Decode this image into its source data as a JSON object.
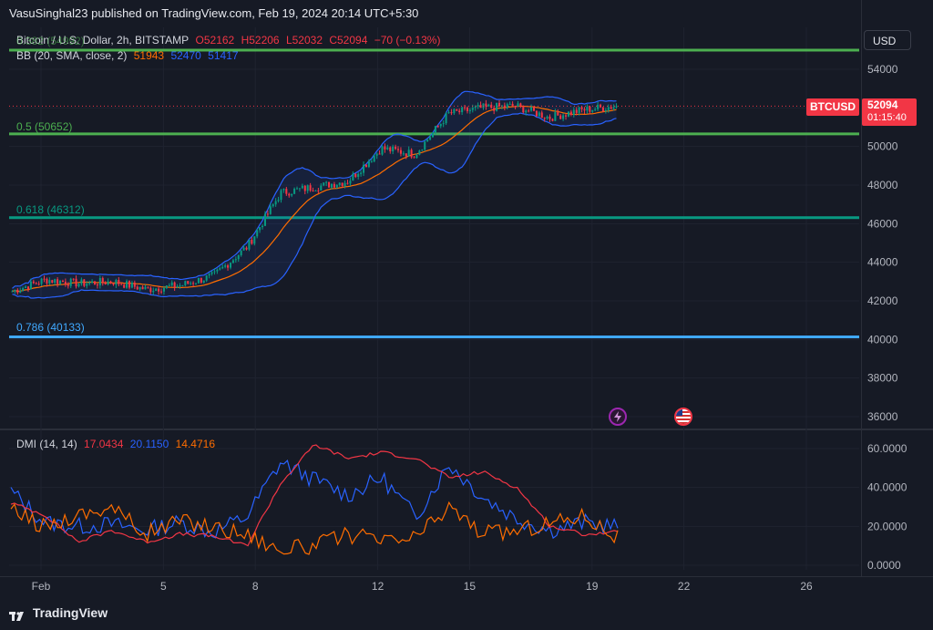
{
  "header": {
    "published": "VasuSinghal23 published on TradingView.com, Feb 19, 2024 20:14 UTC+5:30"
  },
  "currency_button": "USD",
  "symbol_tag": "BTCUSD",
  "last_price": "52094",
  "countdown": "01:15:40",
  "footer_brand": "TradingView",
  "main_legend": {
    "symbol": "Bitcoin / U.S. Dollar, 2h, BITSTAMP",
    "o": "O52162",
    "h": "H52206",
    "l": "L52032",
    "c": "C52094",
    "change": "−70 (−0.13%)",
    "bb_label": "BB (20, SMA, close, 2)",
    "bb_basis": "51943",
    "bb_upper": "52470",
    "bb_lower": "51417"
  },
  "dmi_legend": {
    "label": "DMI (14, 14)",
    "v1": "17.0434",
    "v2": "20.1150",
    "v3": "14.4716"
  },
  "colors": {
    "up": "#089981",
    "down": "#f23645",
    "bb_band": "#2962ff",
    "bb_basis": "#ff6d00",
    "dmi_plus": "#2962ff",
    "dmi_minus": "#f23645",
    "adx": "#ff6d00"
  },
  "fib_levels": [
    {
      "label": "0.382 (54992)",
      "value": 54992,
      "color": "#4caf50"
    },
    {
      "label": "0.5 (50652)",
      "value": 50652,
      "color": "#4caf50"
    },
    {
      "label": "0.618 (46312)",
      "value": 46312,
      "color": "#089981"
    },
    {
      "label": "0.786 (40133)",
      "value": 40133,
      "color": "#40a9ff"
    }
  ],
  "chart_data": [
    {
      "type": "candlestick",
      "title": "Bitcoin / U.S. Dollar, 2h, BITSTAMP",
      "ylim": [
        35000,
        55500
      ],
      "y_ticks": [
        "54000",
        "52000",
        "50000",
        "48000",
        "46000",
        "44000",
        "42000",
        "40000",
        "38000",
        "36000"
      ],
      "x_ticks": [
        "Feb",
        "5",
        "8",
        "12",
        "15",
        "19",
        "22",
        "26"
      ],
      "series": [
        {
          "name": "Price (approx. close)",
          "x": [
            "Feb 1",
            "Feb 2",
            "Feb 3",
            "Feb 4",
            "Feb 5",
            "Feb 6",
            "Feb 7",
            "Feb 8",
            "Feb 9",
            "Feb 10",
            "Feb 11",
            "Feb 12",
            "Feb 13",
            "Feb 14",
            "Feb 15",
            "Feb 16",
            "Feb 17",
            "Feb 18",
            "Feb 19"
          ],
          "values": [
            42500,
            43100,
            42900,
            43000,
            42600,
            42800,
            43300,
            44800,
            47600,
            47900,
            48200,
            49900,
            49600,
            51700,
            52000,
            52100,
            51500,
            51900,
            52094
          ]
        }
      ]
    },
    {
      "type": "line",
      "title": "DMI (14, 14)",
      "ylim": [
        0,
        65
      ],
      "y_ticks": [
        "60.0000",
        "40.0000",
        "20.0000",
        "0.0000"
      ],
      "x": [
        "Feb 1",
        "Feb 2",
        "Feb 3",
        "Feb 4",
        "Feb 5",
        "Feb 6",
        "Feb 7",
        "Feb 8",
        "Feb 9",
        "Feb 10",
        "Feb 11",
        "Feb 12",
        "Feb 13",
        "Feb 14",
        "Feb 15",
        "Feb 16",
        "Feb 17",
        "Feb 18",
        "Feb 19"
      ],
      "series": [
        {
          "values": [
            38,
            22,
            20,
            21,
            18,
            22,
            17,
            25,
            53,
            44,
            36,
            45,
            25,
            52,
            35,
            24,
            18,
            22,
            20
          ]
        },
        {
          "values": [
            32,
            26,
            12,
            18,
            12,
            16,
            15,
            10,
            42,
            62,
            55,
            58,
            55,
            45,
            48,
            40,
            20,
            16,
            17
          ]
        },
        {
          "values": [
            28,
            20,
            26,
            30,
            16,
            23,
            20,
            16,
            8,
            10,
            16,
            12,
            14,
            30,
            16,
            18,
            22,
            26,
            14
          ]
        }
      ]
    }
  ]
}
